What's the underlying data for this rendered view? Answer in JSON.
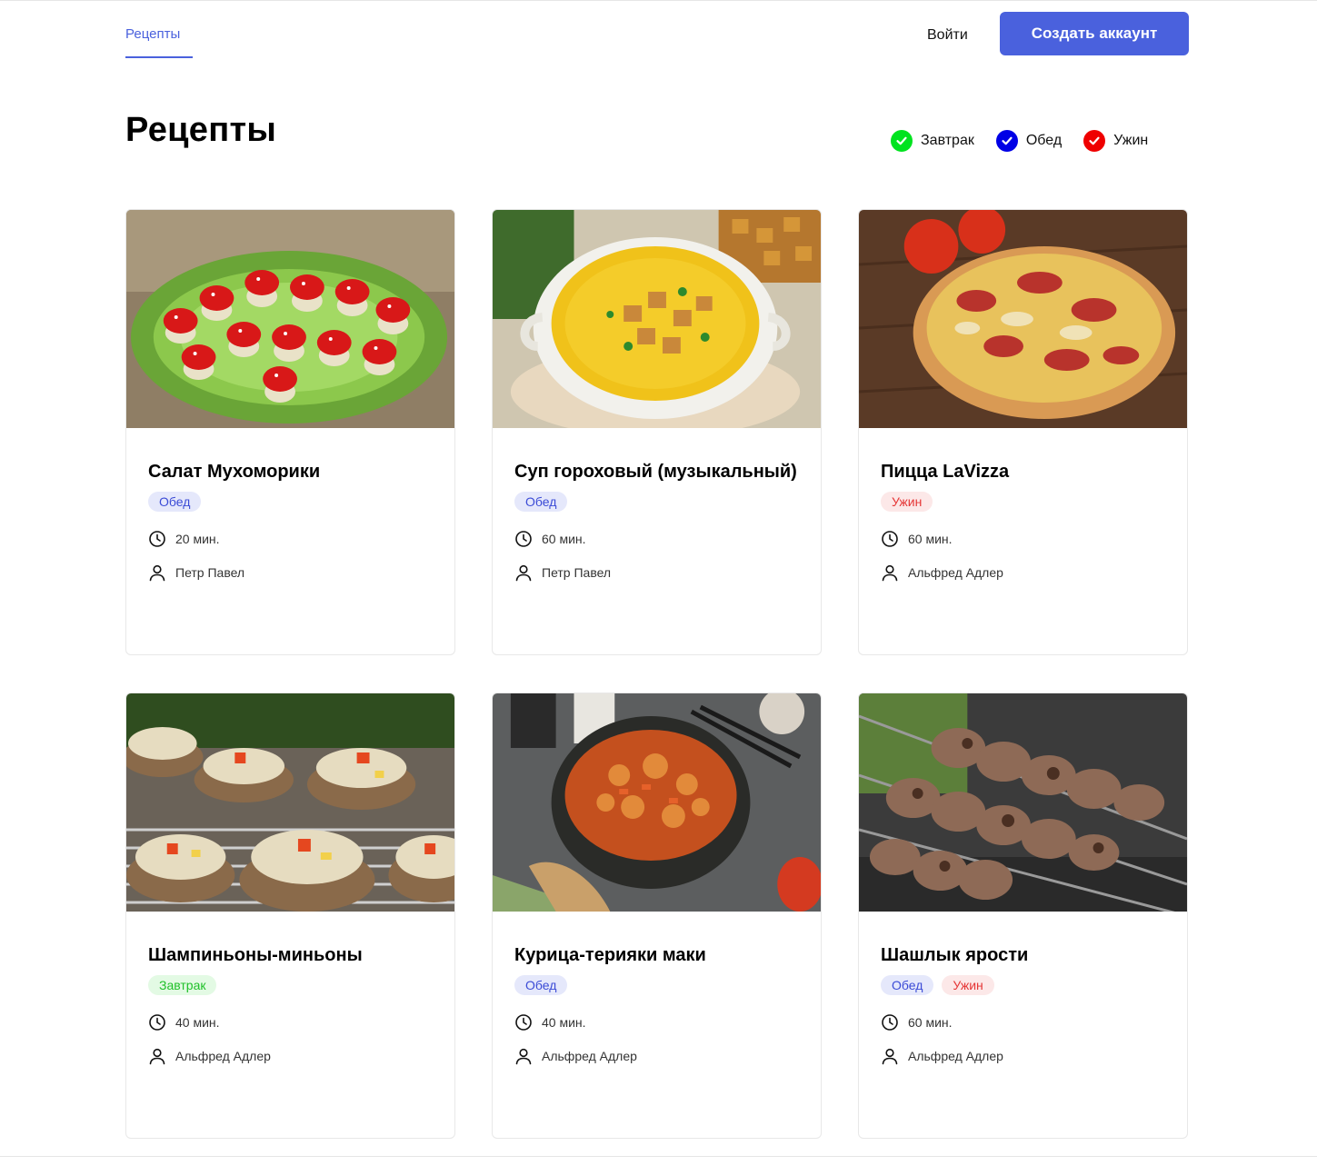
{
  "header": {
    "nav_recipes": "Рецепты",
    "login": "Войти",
    "signup": "Создать аккаунт"
  },
  "page": {
    "title": "Рецепты"
  },
  "filters": [
    {
      "label": "Завтрак",
      "color": "#00e31f",
      "checked": true
    },
    {
      "label": "Обед",
      "color": "#0000e6",
      "checked": true
    },
    {
      "label": "Ужин",
      "color": "#ef0000",
      "checked": true
    }
  ],
  "tag_styles": {
    "Завтрак": {
      "bg": "#e3fae4",
      "fg": "#20c02a"
    },
    "Обед": {
      "bg": "#e5e8fb",
      "fg": "#3b4bd6"
    },
    "Ужин": {
      "bg": "#fce8e8",
      "fg": "#e53535"
    }
  },
  "recipes": [
    {
      "title": "Салат Мухоморики",
      "tags": [
        "Обед"
      ],
      "time": "20 мин.",
      "author": "Петр Павел",
      "image": "salad-image"
    },
    {
      "title": "Суп гороховый (музыкальный)",
      "tags": [
        "Обед"
      ],
      "time": "60 мин.",
      "author": "Петр Павел",
      "image": "soup-image"
    },
    {
      "title": "Пицца LaVizza",
      "tags": [
        "Ужин"
      ],
      "time": "60 мин.",
      "author": "Альфред Адлер",
      "image": "pizza-image"
    },
    {
      "title": "Шампиньоны-миньоны",
      "tags": [
        "Завтрак"
      ],
      "time": "40 мин.",
      "author": "Альфред Адлер",
      "image": "mushrooms-image"
    },
    {
      "title": "Курица-терияки маки",
      "tags": [
        "Обед"
      ],
      "time": "40 мин.",
      "author": "Альфред Адлер",
      "image": "chicken-image"
    },
    {
      "title": "Шашлык ярости",
      "tags": [
        "Обед",
        "Ужин"
      ],
      "time": "60 мин.",
      "author": "Альфред Адлер",
      "image": "shashlik-image"
    }
  ]
}
